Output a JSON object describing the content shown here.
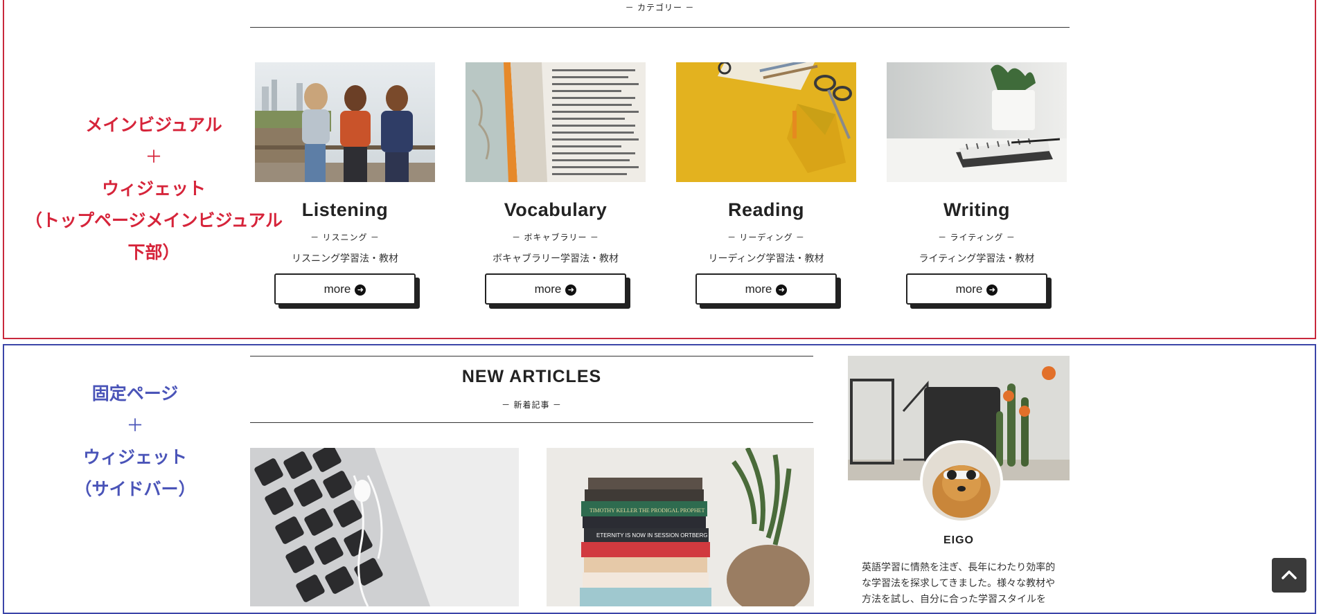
{
  "annotations": {
    "top": {
      "line1": "メインビジュアル",
      "plus": "＋",
      "line2": "ウィジェット",
      "line3": "（トップページメインビジュアル下部）",
      "color": "#d6243a"
    },
    "bottom": {
      "line1": "固定ページ",
      "plus": "＋",
      "line2": "ウィジェット",
      "line3": "（サイドバー）",
      "color": "#4a54b8"
    }
  },
  "category_section": {
    "label": "－ カテゴリー －",
    "cards": [
      {
        "title": "Listening",
        "subtitle": "－ リスニング －",
        "description": "リスニング学習法・教材",
        "button": "more",
        "image": "friends-walking-photo"
      },
      {
        "title": "Vocabulary",
        "subtitle": "－ ボキャブラリー －",
        "description": "ボキャブラリー学習法・教材",
        "button": "more",
        "image": "dictionary-photo"
      },
      {
        "title": "Reading",
        "subtitle": "－ リーディング －",
        "description": "リーディング学習法・教材",
        "button": "more",
        "image": "stationery-photo"
      },
      {
        "title": "Writing",
        "subtitle": "－ ライティング －",
        "description": "ライティング学習法・教材",
        "button": "more",
        "image": "notebook-photo"
      }
    ]
  },
  "new_articles": {
    "title": "NEW ARTICLES",
    "subtitle": "－ 新着記事 －",
    "articles": [
      {
        "image": "laptop-earphones-photo"
      },
      {
        "image": "book-stack-photo",
        "spines": [
          "TIMOTHY KELLER   THE PRODIGAL PROPHET",
          "ETERNITY IS NOW IN SESSION   ORTBERG"
        ]
      }
    ]
  },
  "profile": {
    "name": "EIGO",
    "description": "英語学習に情熱を注ぎ、長年にわたり効率的な学習法を探求してきました。様々な教材や方法を試し、自分に合った学習スタイルを"
  },
  "scroll_top": {
    "icon": "chevron-up-icon"
  }
}
